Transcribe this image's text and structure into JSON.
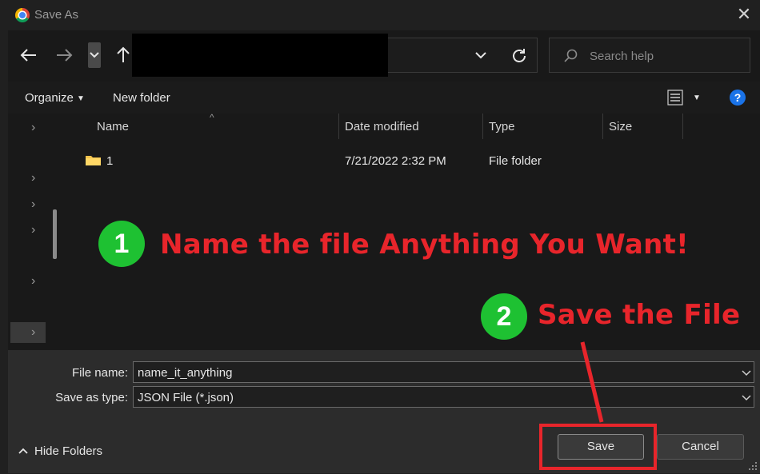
{
  "window": {
    "title": "Save As"
  },
  "nav": {
    "search_placeholder": "Search help"
  },
  "toolbar": {
    "organize_label": "Organize",
    "new_folder_label": "New folder",
    "help_label": "?"
  },
  "columns": {
    "name": "Name",
    "date_modified": "Date modified",
    "type": "Type",
    "size": "Size"
  },
  "files": [
    {
      "name": "1",
      "date_modified": "7/21/2022 2:32 PM",
      "type": "File folder",
      "size": ""
    }
  ],
  "annotations": {
    "step1_number": "1",
    "step1_text": "Name the file Anything You Want!",
    "step2_number": "2",
    "step2_text": "Save the File",
    "highlight_color": "#e8252b",
    "badge_color": "#1ec132"
  },
  "form": {
    "file_name_label": "File name:",
    "file_name_value": "name_it_anything",
    "save_type_label": "Save as type:",
    "save_type_value": "JSON File (*.json)"
  },
  "footer": {
    "hide_folders_label": "Hide Folders",
    "save_label": "Save",
    "cancel_label": "Cancel"
  },
  "icons": {
    "app": "chrome-icon",
    "close": "close-icon",
    "back": "back-arrow-icon",
    "forward": "forward-arrow-icon",
    "up": "up-arrow-icon",
    "refresh": "refresh-icon",
    "search": "search-icon",
    "view": "view-options-icon",
    "help": "help-icon",
    "folder": "folder-icon"
  }
}
